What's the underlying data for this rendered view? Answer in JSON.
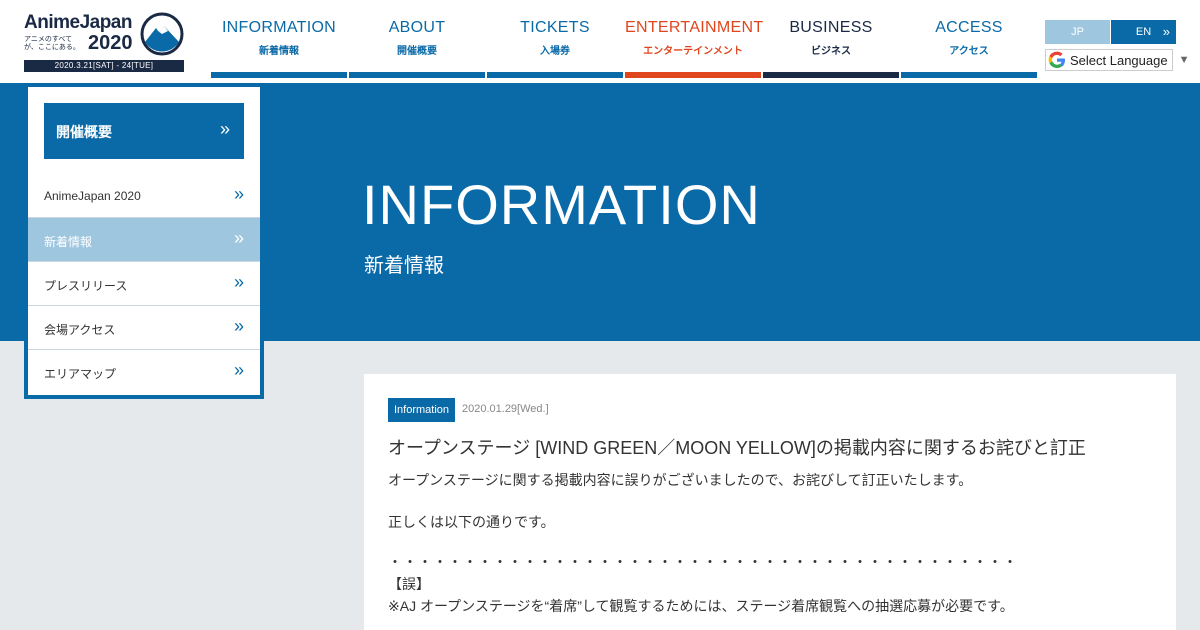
{
  "logo": {
    "title": "AnimeJapan",
    "subtitle": "アニメのすべてが、ここにある。",
    "year": "2020",
    "dates": "2020.3.21[SAT] - 24[TUE]"
  },
  "nav": [
    {
      "en": "INFORMATION",
      "ja": "新着情報",
      "color": "#0a6aa8",
      "bar": "#0a6aa8"
    },
    {
      "en": "ABOUT",
      "ja": "開催概要",
      "color": "#0a6aa8",
      "bar": "#0a6aa8"
    },
    {
      "en": "TICKETS",
      "ja": "入場券",
      "color": "#0a6aa8",
      "bar": "#0a6aa8"
    },
    {
      "en": "ENTERTAINMENT",
      "ja": "エンターテインメント",
      "color": "#e0461e",
      "bar": "#e0461e"
    },
    {
      "en": "BUSINESS",
      "ja": "ビジネス",
      "color": "#1a2a44",
      "bar": "#1a2a44"
    },
    {
      "en": "ACCESS",
      "ja": "アクセス",
      "color": "#0a6aa8",
      "bar": "#0a6aa8"
    }
  ],
  "lang": {
    "jp": "JP",
    "en": "EN",
    "translate": "Select Language"
  },
  "hero": {
    "title": "INFORMATION",
    "subtitle": "新着情報"
  },
  "sidebar": {
    "heading": "開催概要",
    "items": [
      {
        "label": "AnimeJapan 2020",
        "active": false
      },
      {
        "label": "新着情報",
        "active": true
      },
      {
        "label": "プレスリリース",
        "active": false
      },
      {
        "label": "会場アクセス",
        "active": false
      },
      {
        "label": "エリアマップ",
        "active": false
      }
    ]
  },
  "article": {
    "badge": "Information",
    "date": "2020.01.29[Wed.]",
    "title": "オープンステージ [WIND GREEN／MOON YELLOW]の掲載内容に関するお詫びと訂正",
    "para1": "オープンステージに関する掲載内容に誤りがございましたので、お詫びして訂正いたします。",
    "para2": "正しくは以下の通りです。",
    "dots": "・・・・・・・・・・・・・・・・・・・・・・・・・・・・・・・・・・・・・・・・・・",
    "wrong_label": "【誤】",
    "wrong_text": "※AJ オープンステージを“着席”して観覧するためには、ステージ着席観覧への抽選応募が必要です。"
  },
  "colors": {
    "primary": "#0a6aa8",
    "navy": "#1a2a44",
    "accent": "#e0461e",
    "light": "#9fc6df"
  }
}
